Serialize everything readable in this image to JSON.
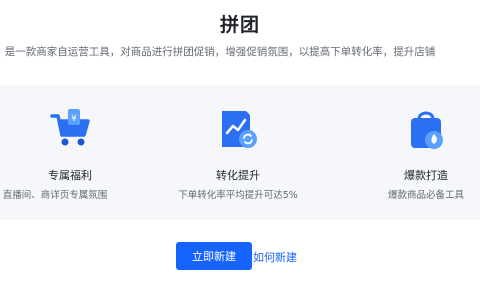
{
  "header": {
    "title": "拼团",
    "subtitle": "是一款商家自运营工具，对商品进行拼团促销，增强促销氛围，以提高下单转化率，提升店铺"
  },
  "features": [
    {
      "icon": "shopping-cart-icon",
      "name": "专属福利",
      "desc": "直播间、商详页专属氛围"
    },
    {
      "icon": "growth-chart-icon",
      "name": "转化提升",
      "desc": "下单转化率平均提升可达5%"
    },
    {
      "icon": "hot-bag-icon",
      "name": "爆款打造",
      "desc": "爆款商品必备工具"
    }
  ],
  "actions": {
    "create_label": "立即新建",
    "howto_label": "如何新建"
  },
  "colors": {
    "accent": "#1664ff",
    "panel": "#f5f7fa"
  }
}
